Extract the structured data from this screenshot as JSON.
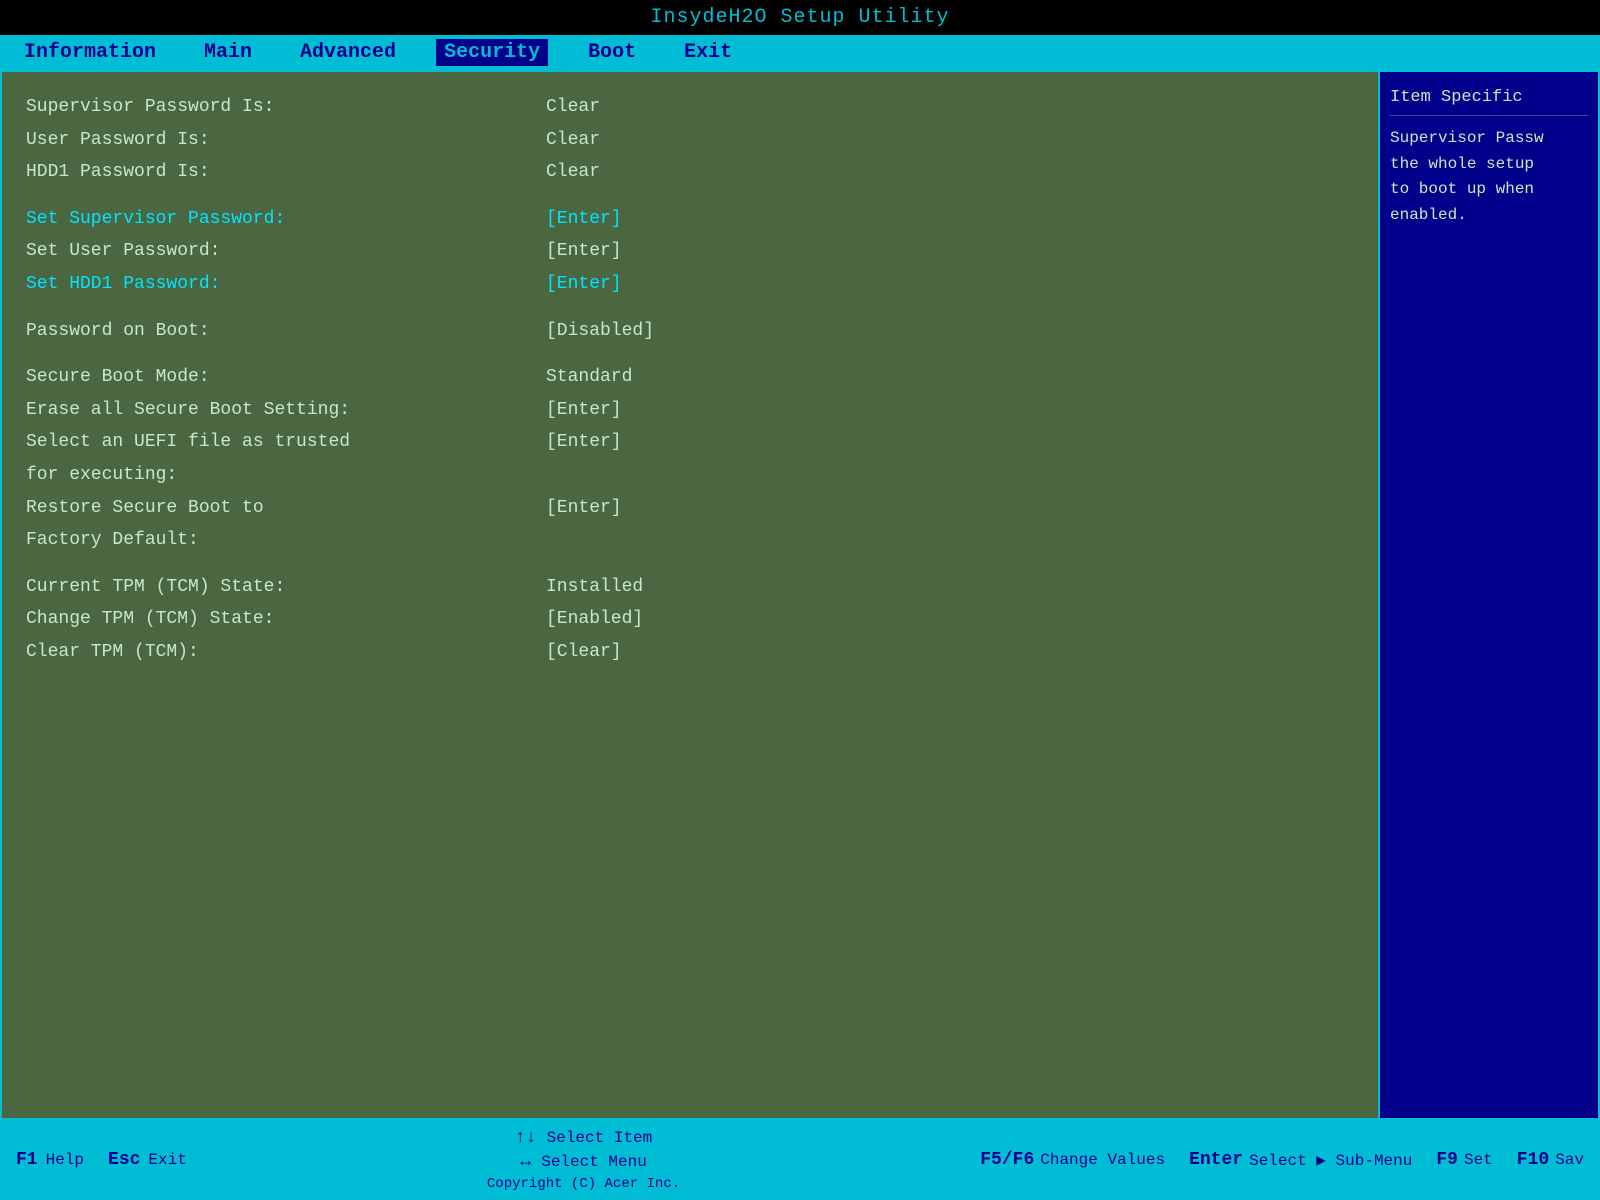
{
  "title_bar": {
    "text": "InsydeH2O Setup Utility"
  },
  "menu": {
    "items": [
      {
        "id": "information",
        "label": "Information",
        "active": false
      },
      {
        "id": "main",
        "label": "Main",
        "active": false
      },
      {
        "id": "advanced",
        "label": "Advanced",
        "active": false
      },
      {
        "id": "security",
        "label": "Security",
        "active": true
      },
      {
        "id": "boot",
        "label": "Boot",
        "active": false
      },
      {
        "id": "exit",
        "label": "Exit",
        "active": false
      }
    ]
  },
  "settings": {
    "rows": [
      {
        "label": "Supervisor Password Is:",
        "value": "Clear",
        "label_highlight": false,
        "value_highlight": false
      },
      {
        "label": "User Password Is:",
        "value": "Clear",
        "label_highlight": false,
        "value_highlight": false
      },
      {
        "label": "HDD1 Password Is:",
        "value": "Clear",
        "label_highlight": false,
        "value_highlight": false
      },
      {
        "spacer": true
      },
      {
        "label": "Set Supervisor Password:",
        "value": "[Enter]",
        "label_highlight": true,
        "value_highlight": true
      },
      {
        "label": "Set User Password:",
        "value": "[Enter]",
        "label_highlight": false,
        "value_highlight": false
      },
      {
        "label": "Set HDD1 Password:",
        "value": "[Enter]",
        "label_highlight": true,
        "value_highlight": true
      },
      {
        "spacer": true
      },
      {
        "label": "Password on Boot:",
        "value": "[Disabled]",
        "label_highlight": false,
        "value_highlight": false
      },
      {
        "spacer": true
      },
      {
        "label": "Secure Boot Mode:",
        "value": "Standard",
        "label_highlight": false,
        "value_highlight": false
      },
      {
        "label": "Erase all Secure Boot Setting:",
        "value": "[Enter]",
        "label_highlight": false,
        "value_highlight": false
      },
      {
        "label": "Select an UEFI file as trusted",
        "value": "[Enter]",
        "label_highlight": false,
        "value_highlight": false
      },
      {
        "label": "for executing:",
        "value": "",
        "label_highlight": false,
        "value_highlight": false
      },
      {
        "label": "Restore Secure Boot to",
        "value": "[Enter]",
        "label_highlight": false,
        "value_highlight": false
      },
      {
        "label": "Factory Default:",
        "value": "",
        "label_highlight": false,
        "value_highlight": false
      },
      {
        "spacer": true
      },
      {
        "label": "Current TPM (TCM) State:",
        "value": "Installed",
        "label_highlight": false,
        "value_highlight": false
      },
      {
        "label": "Change TPM (TCM) State:",
        "value": "[Enabled]",
        "label_highlight": false,
        "value_highlight": false
      },
      {
        "label": "Clear TPM (TCM):",
        "value": "[Clear]",
        "label_highlight": false,
        "value_highlight": false
      }
    ]
  },
  "right_panel": {
    "title": "Item Specific",
    "text": "Supervisor Passw the whole setup to boot up when enabled."
  },
  "bottom_bar": {
    "f1_label": "F1",
    "f1_desc": "Help",
    "esc_label": "Esc",
    "esc_desc": "Exit",
    "up_down_label": "↑↓",
    "up_down_desc": "Select Item",
    "left_right_label": "↔",
    "left_right_desc": "Select Menu",
    "f5f6_label": "F5/F6",
    "f5f6_desc": "Change Values",
    "enter_label": "Enter",
    "enter_desc": "Select ▶ Sub-Menu",
    "f9_label": "F9",
    "f9_desc": "Set",
    "f10_label": "F10",
    "f10_desc": "Sav",
    "copyright": "Copyright (C) Acer Inc."
  }
}
